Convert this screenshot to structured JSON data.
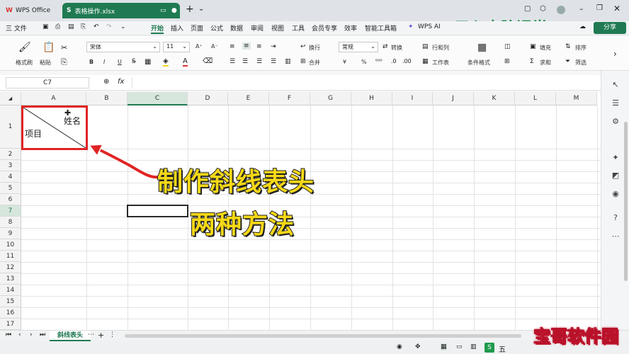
{
  "titlebar": {
    "app_tab": "WPS Office",
    "file_tab": "表格操作.xlsx",
    "file_icon": "S",
    "add_tab": "+",
    "dropdown": "⌄",
    "share_label": "分享"
  },
  "menubar": {
    "file_menu": "三 文件",
    "items": [
      "开始",
      "插入",
      "页面",
      "公式",
      "数据",
      "审阅",
      "视图",
      "工具",
      "会员专享",
      "效率",
      "智能工具箱",
      "WPS AI"
    ],
    "active": "开始"
  },
  "ribbon": {
    "format_painter": "格式刷",
    "paste": "粘贴",
    "font_name": "宋体",
    "font_size": "11",
    "wrap": "换行",
    "merge": "合并",
    "number_format": "常规",
    "convert": "转换",
    "rows_cols": "行和列",
    "worksheet": "工作表",
    "cond_format": "条件格式",
    "fill": "填充",
    "sort": "排序",
    "sum": "求和",
    "filter": "筛选",
    "bold": "B",
    "italic": "I",
    "underline": "U",
    "percent": "%",
    "currency": "¥",
    "font_grow": "A⁺",
    "font_shrink": "A⁻"
  },
  "formula": {
    "name_box": "C7",
    "fx": "fx",
    "value": ""
  },
  "grid": {
    "columns": [
      "A",
      "B",
      "C",
      "D",
      "E",
      "F",
      "G",
      "H",
      "I",
      "J",
      "K",
      "L",
      "M"
    ],
    "rows": [
      "1",
      "2",
      "3",
      "4",
      "5",
      "6",
      "7",
      "8",
      "9",
      "10",
      "11",
      "12",
      "13",
      "14",
      "15",
      "16",
      "17",
      "18"
    ],
    "cell_a1_top_right": "姓名",
    "cell_a1_bottom_left": "项目",
    "selected_cell": "C7"
  },
  "overlay": {
    "caption_line1": "制作斜线表头",
    "caption_line2": "两种方法",
    "brand": "元心电脑课堂",
    "watermark": "宝哥软件园",
    "highlight_color": "#e02424",
    "caption_color": "#f5d817"
  },
  "sheets": {
    "active": "斜线表头",
    "add": "+"
  },
  "status": {
    "ime": "五"
  }
}
